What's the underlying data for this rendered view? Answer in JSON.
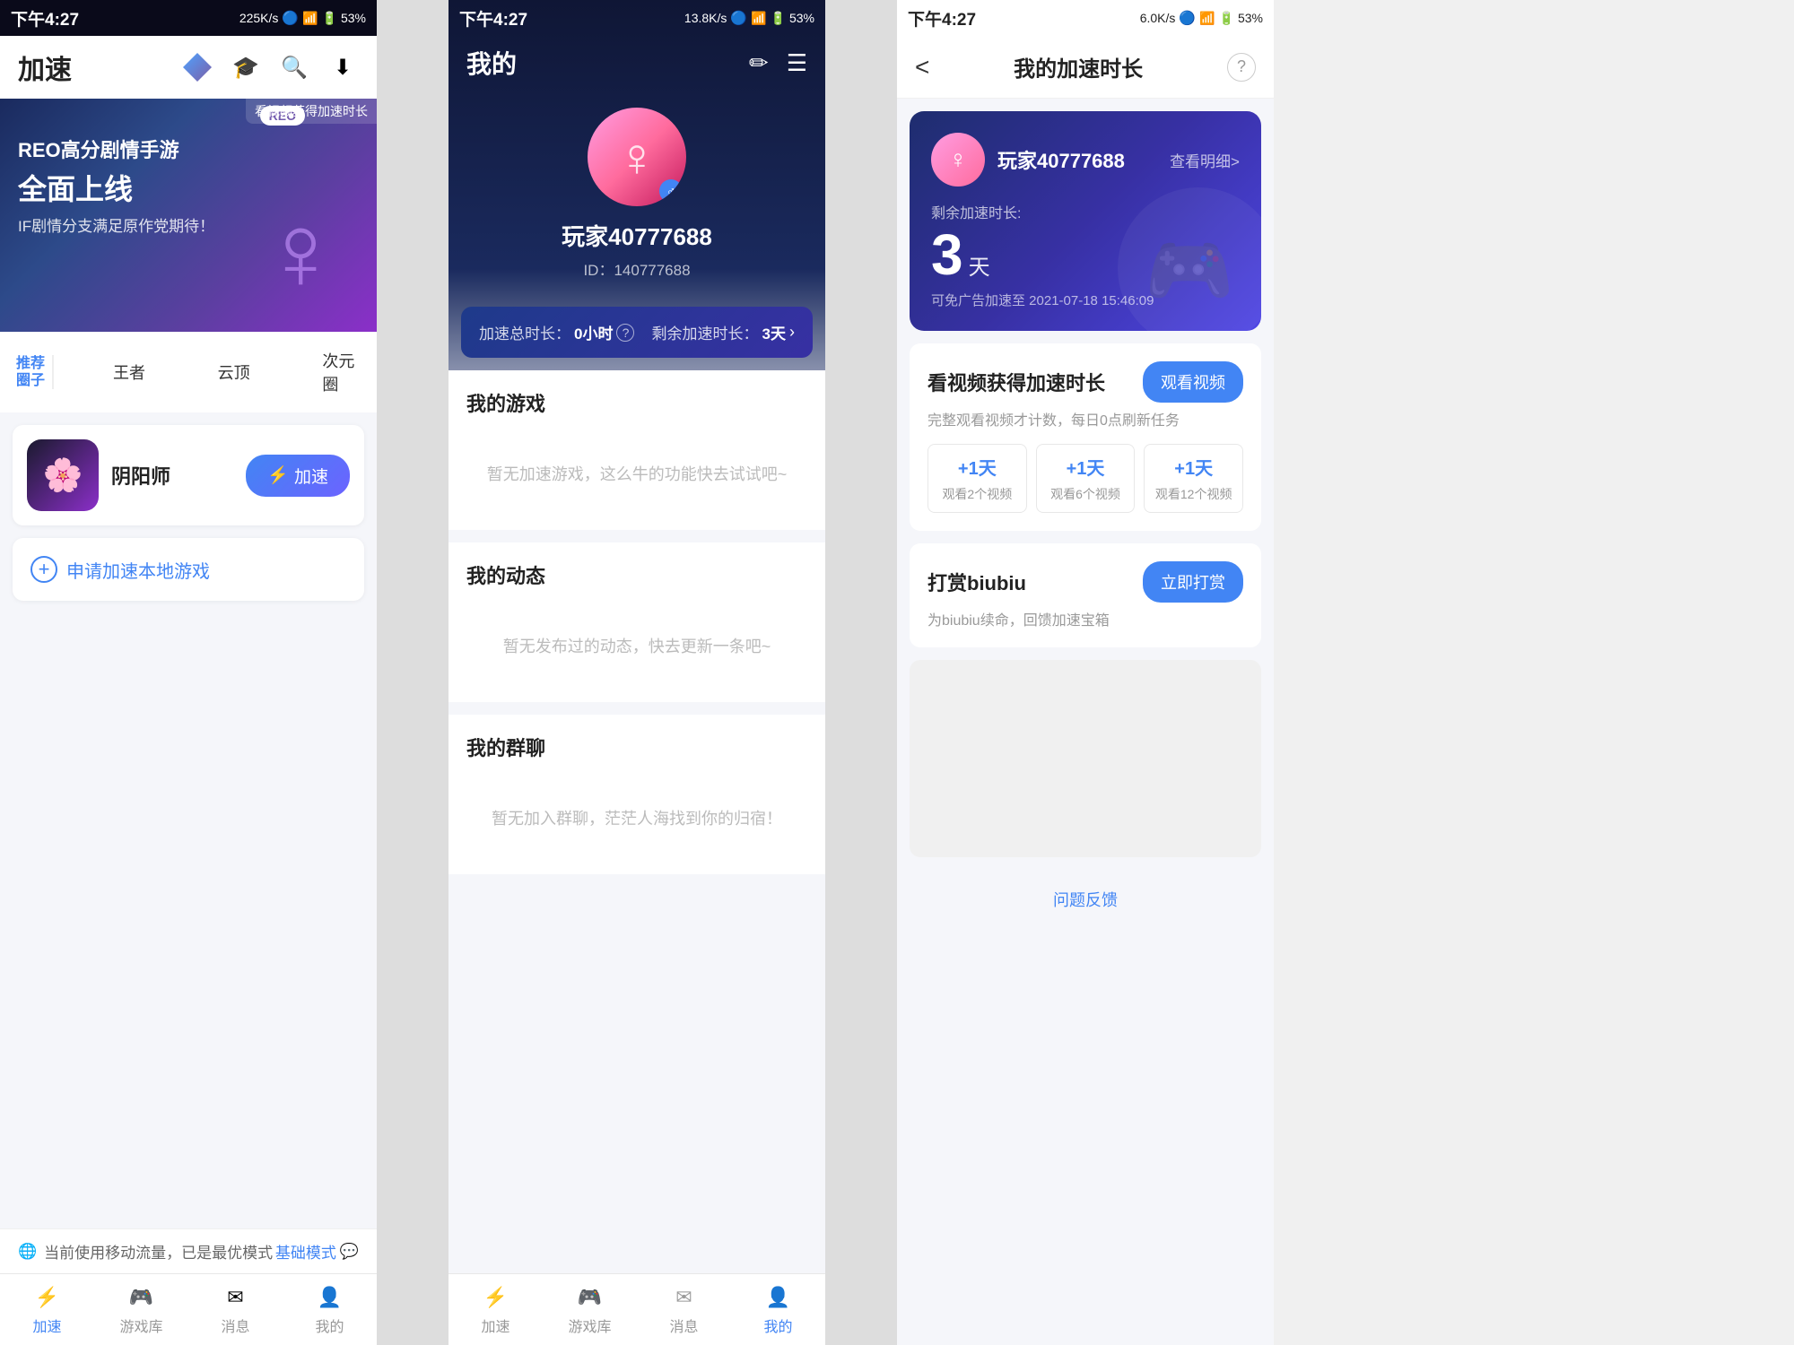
{
  "panel1": {
    "status": {
      "time": "下午4:27",
      "speed": "225K/s",
      "battery": "53%"
    },
    "topbar": {
      "title": "加速",
      "watch_video_tip": "看视频获得加速时长"
    },
    "banner": {
      "badge": "REO",
      "tag": "看视频获得加速时长",
      "line1": "REO高分剧情手游",
      "line2": "全面上线",
      "line3": "IF剧情分支满足原作党期待！"
    },
    "categories": {
      "label": "推荐\n圈子",
      "items": [
        {
          "name": "王者",
          "icon_type": "zhangzhe"
        },
        {
          "name": "云顶",
          "icon_type": "yunding"
        },
        {
          "name": "次元圈",
          "icon_type": "ciyuan"
        }
      ]
    },
    "game_card": {
      "name": "阴阳师",
      "button": "加速"
    },
    "apply": {
      "text": "申请加速本地游戏"
    },
    "notice": {
      "text": "当前使用移动流量，已是最优模式",
      "mode": "基础模式"
    },
    "nav": {
      "items": [
        {
          "label": "加速",
          "active": true
        },
        {
          "label": "游戏库",
          "active": false
        },
        {
          "label": "消息",
          "active": false
        },
        {
          "label": "我的",
          "active": false
        }
      ]
    }
  },
  "panel2": {
    "status": {
      "time": "下午4:27",
      "speed": "13.8K/s",
      "battery": "53%"
    },
    "header": {
      "title": "我的"
    },
    "profile": {
      "name": "玩家40777688",
      "id": "ID：140777688"
    },
    "speed_bar": {
      "total_label": "加速总时长：",
      "total_value": "0小时",
      "help_icon": "?",
      "remaining_label": "剩余加速时长：",
      "remaining_value": "3天",
      "arrow": ">"
    },
    "sections": [
      {
        "title": "我的游戏",
        "empty_text": "暂无加速游戏，这么牛的功能快去试试吧~"
      },
      {
        "title": "我的动态",
        "empty_text": "暂无发布过的动态，快去更新一条吧~"
      },
      {
        "title": "我的群聊",
        "empty_text": "暂无加入群聊，茫茫人海找到你的归宿！"
      }
    ],
    "nav": {
      "items": [
        {
          "label": "加速",
          "active": false
        },
        {
          "label": "游戏库",
          "active": false
        },
        {
          "label": "消息",
          "active": false
        },
        {
          "label": "我的",
          "active": true
        }
      ]
    }
  },
  "panel3": {
    "status": {
      "time": "下午4:27",
      "speed": "6.0K/s",
      "battery": "53%"
    },
    "topbar": {
      "back": "<",
      "title": "我的加速时长",
      "help": "?"
    },
    "user_card": {
      "username": "玩家40777688",
      "detail_link": "查看明细>",
      "remaining_label": "剩余加速时长:",
      "days": "3",
      "days_unit": "天",
      "expire_text": "可免广告加速至 2021-07-18 15:46:09"
    },
    "video_section": {
      "title": "看视频获得加速时长",
      "desc": "完整观看视频才计数，每日0点刷新任务",
      "button": "观看视频",
      "rewards": [
        {
          "plus": "+1天",
          "task": "观看2个视频"
        },
        {
          "plus": "+1天",
          "task": "观看6个视频"
        },
        {
          "plus": "+1天",
          "task": "观看12个视频"
        }
      ]
    },
    "tip_section": {
      "title": "打赏biubiu",
      "desc": "为biubiu续命，回馈加速宝箱",
      "button": "立即打赏"
    },
    "feedback": {
      "text": "问题反馈"
    }
  }
}
